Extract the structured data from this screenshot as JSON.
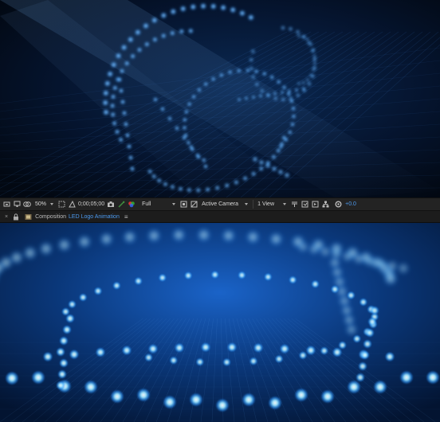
{
  "viewer_toolbar": {
    "zoom": "50%",
    "timecode": "0;00;05;00",
    "resolution": "Full",
    "camera": "Active Camera",
    "views": "1 View",
    "exposure": "+0.0"
  },
  "comp_panel": {
    "tab_prefix": "Composition",
    "comp_name": "LED Logo Animation",
    "menu_glyph": "≡"
  },
  "icons": [
    "always-preview-icon",
    "monitor-icon",
    "mask-icon",
    "region-of-interest-icon",
    "transparency-grid-icon",
    "camera-snapshot-icon",
    "show-snapshot-icon",
    "color-channel-icon",
    "fast-preview-icon",
    "flowchart-icon",
    "exposure-reset-icon"
  ],
  "colors": {
    "accent": "#4d9bf0",
    "led": "#5fc4ff",
    "background": "#02122e"
  }
}
